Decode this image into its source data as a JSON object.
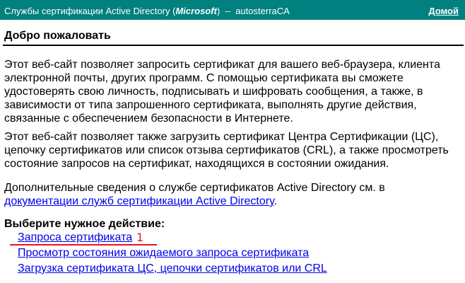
{
  "header": {
    "title_prefix": "Службы сертификации Active Directory (",
    "title_brand": "Microsoft",
    "title_suffix": ")",
    "separator": "--",
    "ca_name": "autosterraCA",
    "home_link": "Домой",
    "background_color": "#00807e"
  },
  "main": {
    "page_title": "Добро пожаловать",
    "paragraph1": "Этот веб-сайт позволяет запросить сертификат для вашего веб-браузера, клиента электронной почты, других программ. С помощью сертификата вы сможете удостоверять свою личность, подписывать и шифровать сообщения, а также, в зависимости от типа запрошенного сертификата, выполнять другие действия, связанные с обеспечением безопасности в Интернете.",
    "paragraph2": "Этот веб-сайт позволяет также загрузить сертификат Центра Сертификации (ЦС), цепочку сертификатов или список отзыва сертификатов (CRL), а также просмотреть состояние запросов на сертификат, находящихся в состоянии ожидания.",
    "paragraph3_prefix": "Дополнительные сведения о службе сертификатов Active Directory см. в",
    "paragraph3_link": "документации служб сертификации Active Directory",
    "paragraph3_suffix": ".",
    "choose_heading": "Выберите нужное действие:",
    "actions": [
      {
        "label": "Запроса сертификата"
      },
      {
        "label": "Просмотр состояния ожидаемого запроса сертификата"
      },
      {
        "label": "Загрузка сертификата ЦС, цепочки сертификатов или CRL"
      }
    ],
    "link_color": "#0000ee"
  },
  "annotation": {
    "number": "1",
    "color": "#e8141b"
  }
}
